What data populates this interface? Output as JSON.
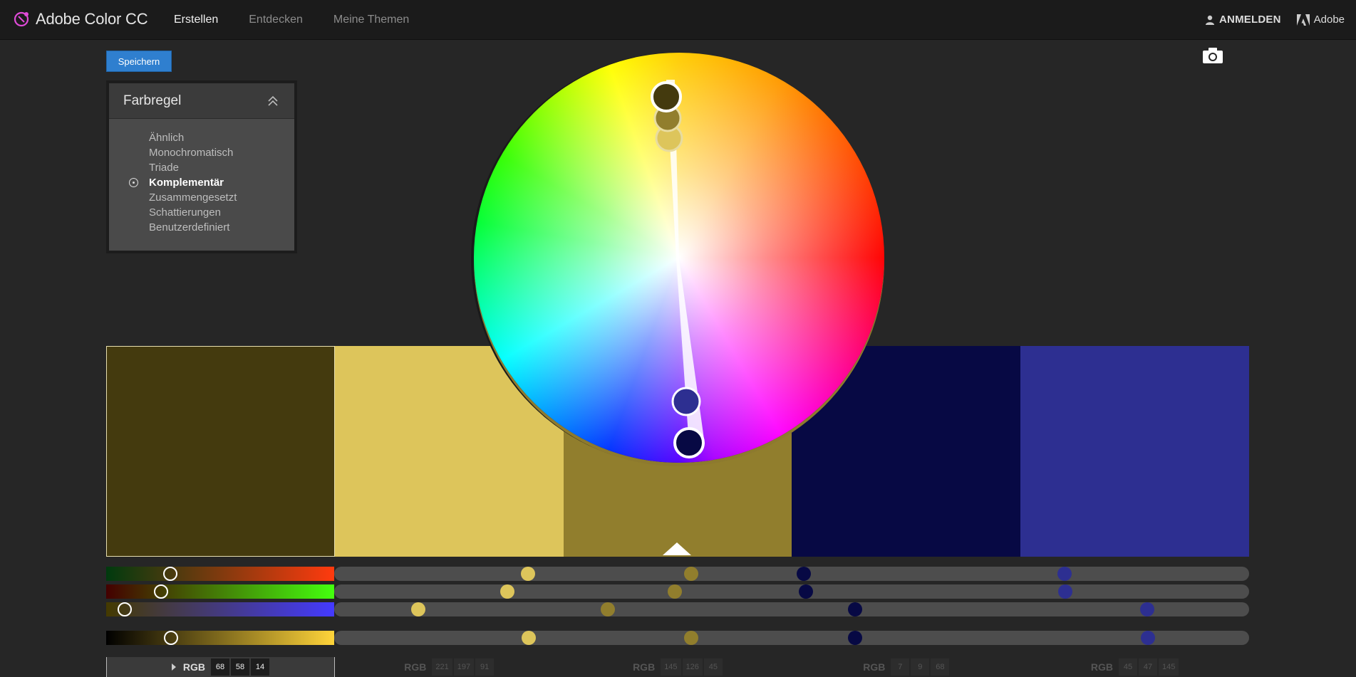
{
  "app": {
    "title": "Adobe Color CC"
  },
  "nav": {
    "create": "Erstellen",
    "explore": "Entdecken",
    "my_themes": "Meine Themen"
  },
  "account": {
    "signin": "ANMELDEN",
    "adobe": "Adobe"
  },
  "toolbar": {
    "save_label": "Speichern"
  },
  "rule": {
    "title": "Farbregel",
    "items": [
      {
        "label": "Ähnlich",
        "active": false
      },
      {
        "label": "Monochromatisch",
        "active": false
      },
      {
        "label": "Triade",
        "active": false
      },
      {
        "label": "Komplementär",
        "active": true
      },
      {
        "label": "Zusammengesetzt",
        "active": false
      },
      {
        "label": "Schattierungen",
        "active": false
      },
      {
        "label": "Benutzerdefiniert",
        "active": false
      }
    ]
  },
  "mode_label": "RGB",
  "swatches": [
    {
      "hex": "#443a0e",
      "rgb": [
        "68",
        "58",
        "14"
      ],
      "selected": true
    },
    {
      "hex": "#ddc55b",
      "rgb": [
        "221",
        "197",
        "91"
      ],
      "selected": false
    },
    {
      "hex": "#917e2d",
      "rgb": [
        "145",
        "126",
        "45"
      ],
      "selected": false
    },
    {
      "hex": "#070944",
      "rgb": [
        "7",
        "9",
        "68"
      ],
      "selected": false
    },
    {
      "hex": "#2d2f91",
      "rgb": [
        "45",
        "47",
        "145"
      ],
      "selected": false
    }
  ],
  "icons": {
    "logo": "adobe-color-logo-icon",
    "user": "user-icon",
    "adobe": "adobe-logo-icon",
    "camera": "camera-icon",
    "collapse": "chevron-double-up-icon",
    "expand": "triangle-right-icon"
  }
}
